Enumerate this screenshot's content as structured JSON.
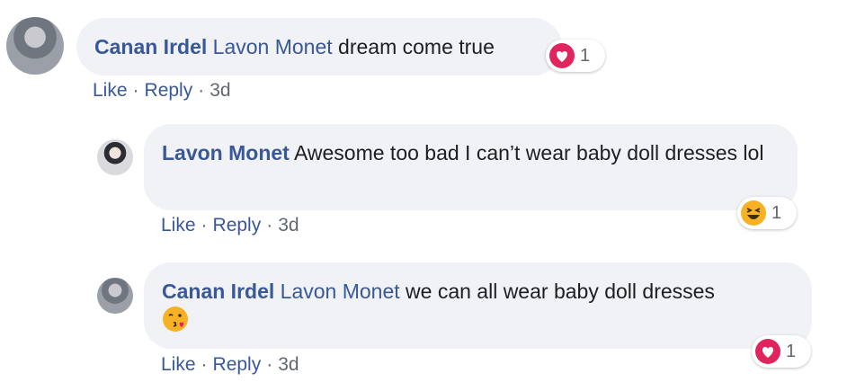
{
  "comments": [
    {
      "author": "Canan Irdel",
      "mention": "Lavon Monet",
      "text": " dream come true",
      "actions": {
        "like": "Like",
        "reply": "Reply",
        "sep": "·",
        "time": "3d"
      },
      "reaction": {
        "icon": "heart-reaction-icon",
        "count": "1"
      }
    },
    {
      "author": "Lavon Monet",
      "text": " Awesome too bad I can’t wear baby doll dresses lol",
      "actions": {
        "like": "Like",
        "reply": "Reply",
        "sep": "·",
        "time": "3d"
      },
      "reaction": {
        "icon": "laughing-face-reaction-icon",
        "count": "1"
      }
    },
    {
      "author": "Canan Irdel",
      "mention": "Lavon Monet",
      "text": " we can all wear baby doll dresses",
      "inline_emoji": "kissing-face-emoji",
      "actions": {
        "like": "Like",
        "reply": "Reply",
        "sep": "·",
        "time": "3d"
      },
      "reaction": {
        "icon": "heart-reaction-icon",
        "count": "1"
      }
    }
  ],
  "colors": {
    "link": "#385898",
    "bubble": "#f0f2f5",
    "heart": "#e0245e",
    "haha": "#f7b125"
  }
}
